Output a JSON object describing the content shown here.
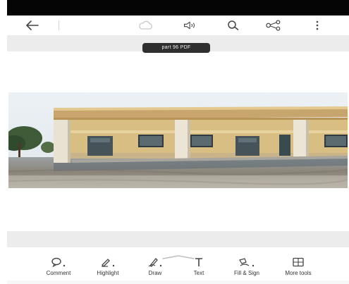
{
  "colors": {
    "status_bar": "#050505",
    "toolbar_bg": "#ffffff",
    "strip_bg": "#ececec",
    "badge_bg": "#2f2f2f",
    "badge_text": "#f2f2f2",
    "icon": "#444444"
  },
  "toolbar": {
    "icons": [
      "back-arrow-icon",
      "cloud-icon",
      "read-aloud-icon",
      "search-icon",
      "share-icon",
      "more-vertical-icon"
    ]
  },
  "document": {
    "file_name": "part 96 PDF",
    "page_image": "photo of a single-storey building with a long veranda, cream walls, dark windows and doors, trees at left, bare ground in front"
  },
  "bottom_toolbar": {
    "tools": [
      {
        "label": "Comment",
        "icon": "comment-icon"
      },
      {
        "label": "Highlight",
        "icon": "highlight-icon"
      },
      {
        "label": "Draw",
        "icon": "draw-icon"
      },
      {
        "label": "Text",
        "icon": "text-icon"
      },
      {
        "label": "Fill & Sign",
        "icon": "fill-sign-icon"
      },
      {
        "label": "More tools",
        "icon": "more-tools-icon"
      }
    ]
  }
}
